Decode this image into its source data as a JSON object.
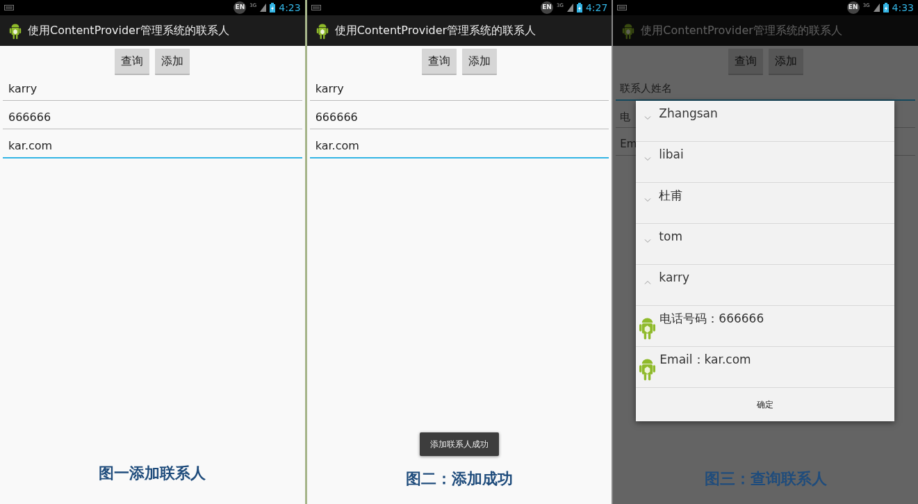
{
  "panels": [
    {
      "status_bar": {
        "ime": "EN",
        "network": "3G",
        "time": "4:23"
      },
      "title": "使用ContentProvider管理系统的联系人",
      "dimmed": false,
      "buttons": [
        "查询",
        "添加"
      ],
      "fields": [
        {
          "value": "karry",
          "focused": false
        },
        {
          "value": "666666",
          "focused": false
        },
        {
          "value": "kar.com",
          "focused": true
        }
      ],
      "caption": "图一添加联系人"
    },
    {
      "status_bar": {
        "ime": "EN",
        "network": "3G",
        "time": "4:27"
      },
      "title": "使用ContentProvider管理系统的联系人",
      "dimmed": false,
      "buttons": [
        "查询",
        "添加"
      ],
      "fields": [
        {
          "value": "karry",
          "focused": false
        },
        {
          "value": "666666",
          "focused": false
        },
        {
          "value": "kar.com",
          "focused": true
        }
      ],
      "toast": "添加联系人成功",
      "caption": "图二：添加成功"
    },
    {
      "status_bar": {
        "ime": "EN",
        "network": "3G",
        "time": "4:33"
      },
      "title": "使用ContentProvider管理系统的联系人",
      "dimmed": true,
      "buttons": [
        "查询",
        "添加"
      ],
      "fields": [
        {
          "placeholder": "联系人姓名",
          "focused": true
        },
        {
          "placeholder": "电",
          "focused": false
        },
        {
          "placeholder": "Em",
          "focused": false
        }
      ],
      "dialog": {
        "groups": [
          {
            "label": "Zhangsan",
            "expanded": false
          },
          {
            "label": "libai",
            "expanded": false
          },
          {
            "label": "杜甫",
            "expanded": false
          },
          {
            "label": "tom",
            "expanded": false
          },
          {
            "label": "karry",
            "expanded": true,
            "children": [
              {
                "label": "电话号码：666666"
              },
              {
                "label": "Email：kar.com"
              }
            ]
          }
        ],
        "button": "确定"
      },
      "caption": "图三：查询联系人"
    }
  ]
}
